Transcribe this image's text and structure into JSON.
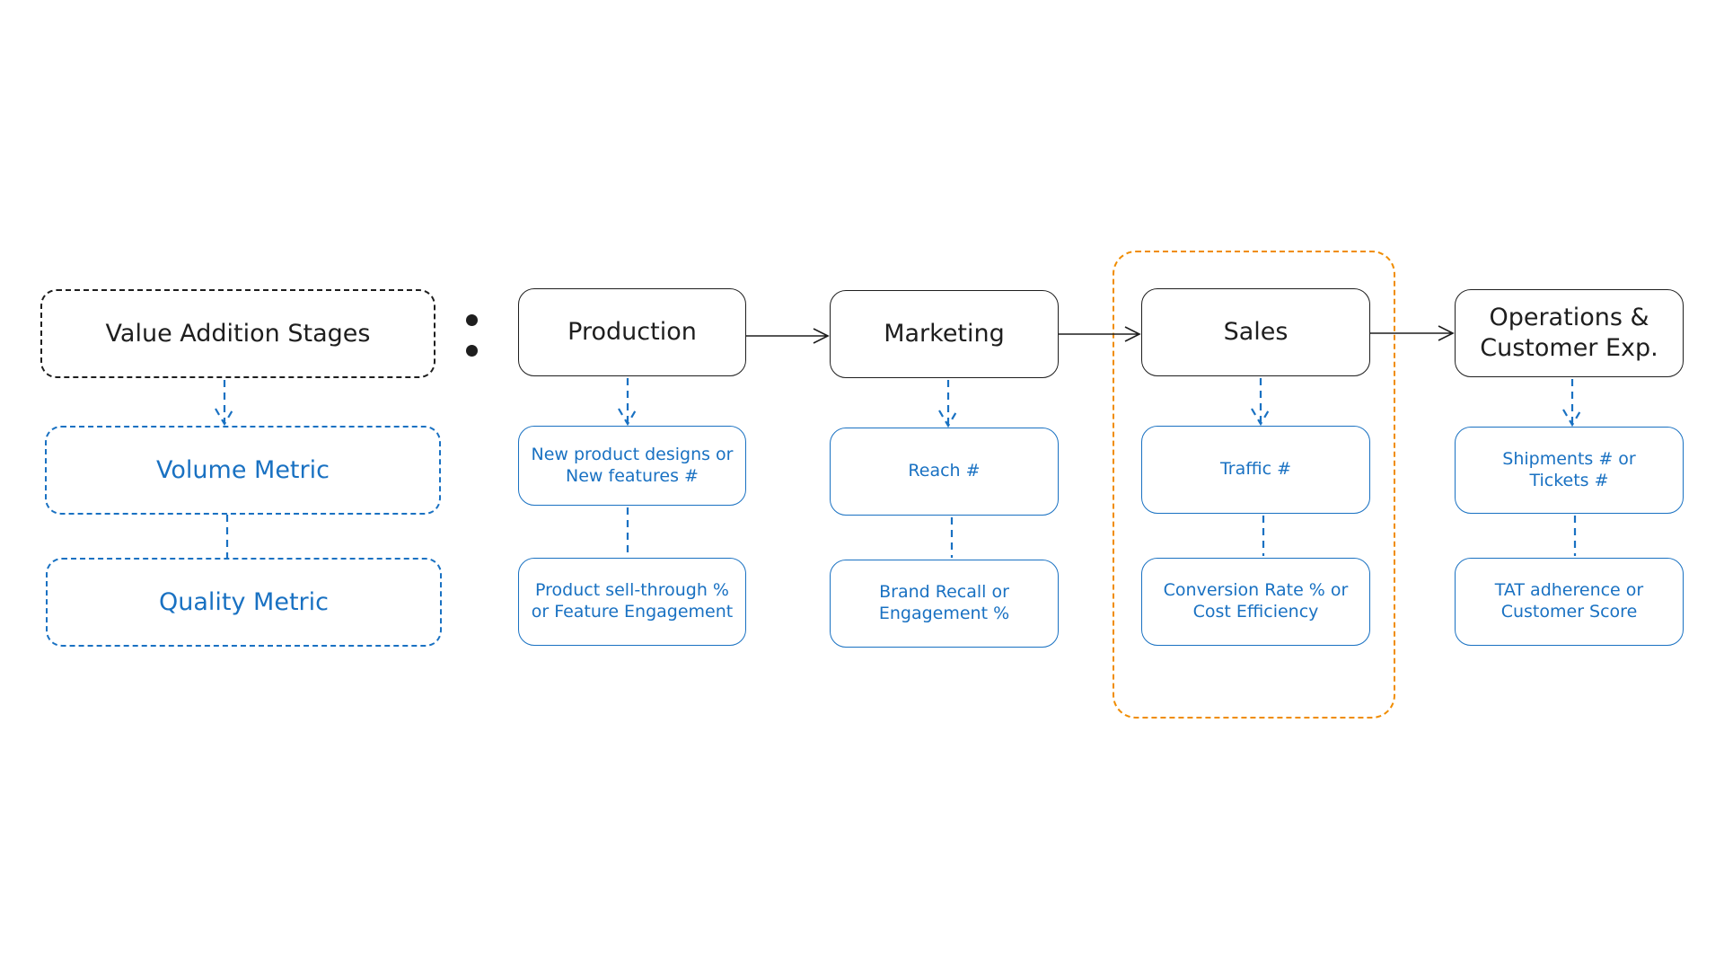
{
  "colors": {
    "stage": "#1e1e1e",
    "metric": "#1971c2",
    "highlight": "#f08c00"
  },
  "legend": {
    "stage_label": "Value Addition Stages",
    "volume_label": "Volume Metric",
    "quality_label": "Quality Metric"
  },
  "stages": [
    {
      "name": "Production",
      "volume": "New product designs or New features #",
      "quality": "Product sell-through % or Feature Engagement"
    },
    {
      "name": "Marketing",
      "volume": "Reach #",
      "quality": "Brand Recall or Engagement %"
    },
    {
      "name": "Sales",
      "volume": "Traffic #",
      "quality": "Conversion Rate % or Cost Efficiency",
      "highlighted": true
    },
    {
      "name": "Operations & Customer Exp.",
      "volume": "Shipments # or Tickets #",
      "quality": "TAT adherence or Customer Score"
    }
  ]
}
